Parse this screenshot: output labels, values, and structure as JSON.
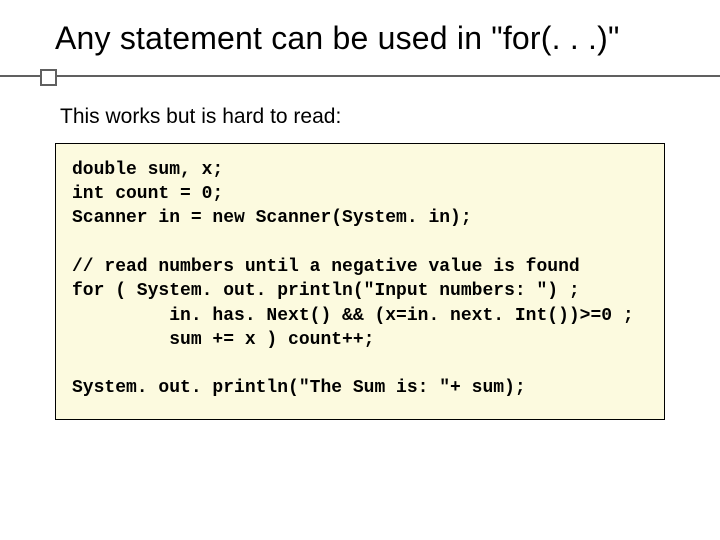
{
  "title": "Any statement can be used in \"for(. . .)\"",
  "subtitle": "This works but is hard to read:",
  "code": "double sum, x;\nint count = 0;\nScanner in = new Scanner(System. in);\n\n// read numbers until a negative value is found\nfor ( System. out. println(\"Input numbers: \") ;\n         in. has. Next() && (x=in. next. Int())>=0 ;\n         sum += x ) count++;\n\nSystem. out. println(\"The Sum is: \"+ sum);"
}
